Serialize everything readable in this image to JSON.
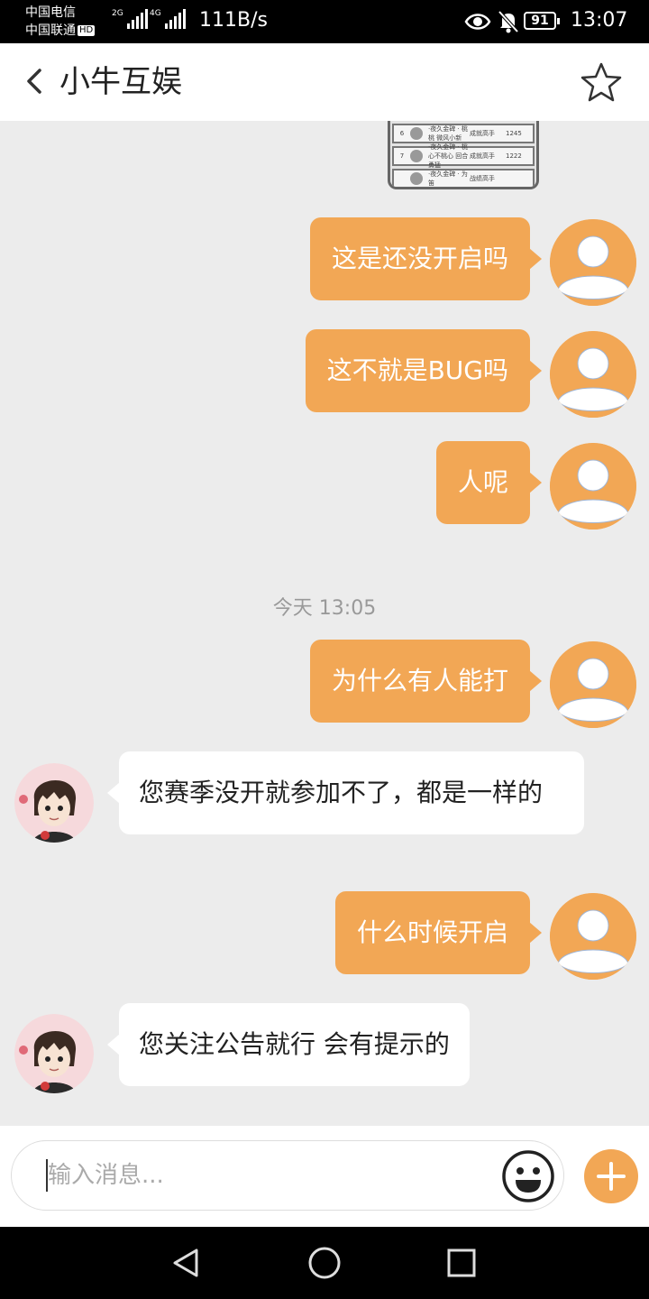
{
  "status_bar": {
    "carrier_1": "中国电信",
    "carrier_2": "中国联通",
    "hd_badge": "HD",
    "signal_1_tag": "2G",
    "signal_2_tag": "4G",
    "net_speed": "111B/s",
    "battery": "91",
    "time": "13:07",
    "icons": [
      "eye-icon",
      "bell-muted-icon",
      "battery-icon"
    ]
  },
  "header": {
    "title": "小牛互娱",
    "back_icon": "chevron-left-icon",
    "favorite_icon": "star-outline-icon"
  },
  "screenshot_thumb": {
    "rows": [
      {
        "num": "6",
        "name": "·夜久金碑 · 桃桃 微风小新",
        "status": "成就高手",
        "score": "1245"
      },
      {
        "num": "7",
        "name": "·夜久金碑 · 桃心不桃心 回合勇猛",
        "status": "成就高手",
        "score": "1222"
      },
      {
        "num": "",
        "name": "·夜久金碑 · 为笛",
        "status": "战绩高手",
        "score": ""
      }
    ]
  },
  "messages": [
    {
      "from": "user",
      "text": "这是还没开启吗"
    },
    {
      "from": "user",
      "text": "这不就是BUG吗"
    },
    {
      "from": "user",
      "text": "人呢"
    },
    {
      "from": "user",
      "text": "为什么有人能打"
    },
    {
      "from": "agent",
      "text": "您赛季没开就参加不了，都是一样的"
    },
    {
      "from": "user",
      "text": "什么时候开启"
    },
    {
      "from": "agent",
      "text": "您关注公告就行 会有提示的"
    }
  ],
  "timestamp": "今天 13:05",
  "input": {
    "placeholder": "输入消息..."
  },
  "colors": {
    "accent": "#f2a755",
    "chat_bg": "#ececec",
    "bubble_in": "#ffffff",
    "timestamp": "#999999"
  },
  "nav": {
    "icons": [
      "back-triangle-icon",
      "home-circle-icon",
      "recents-square-icon"
    ]
  }
}
